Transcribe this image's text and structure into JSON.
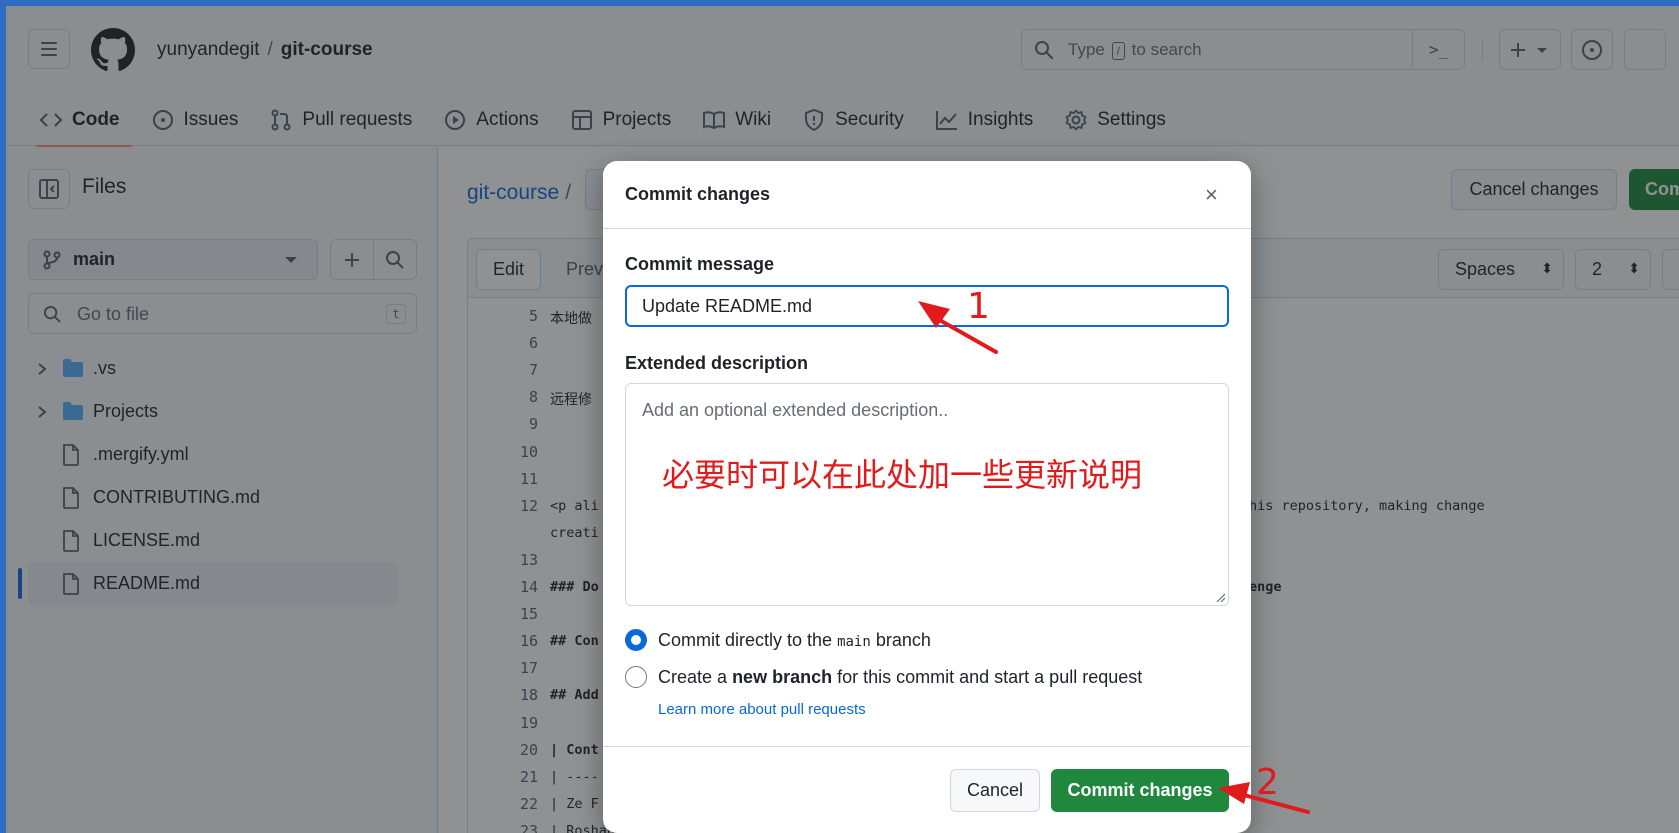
{
  "header": {
    "owner": "yunyandegit",
    "separator": "/",
    "repo": "git-course",
    "search_placeholder_before": "Type",
    "search_key": "/",
    "search_placeholder_after": "to search",
    "command_glyph": ">_"
  },
  "nav": {
    "tabs": [
      {
        "label": "Code",
        "icon": "code-icon"
      },
      {
        "label": "Issues",
        "icon": "issue-icon"
      },
      {
        "label": "Pull requests",
        "icon": "pull-request-icon"
      },
      {
        "label": "Actions",
        "icon": "play-icon"
      },
      {
        "label": "Projects",
        "icon": "table-icon"
      },
      {
        "label": "Wiki",
        "icon": "book-icon"
      },
      {
        "label": "Security",
        "icon": "shield-icon"
      },
      {
        "label": "Insights",
        "icon": "graph-icon"
      },
      {
        "label": "Settings",
        "icon": "gear-icon"
      }
    ]
  },
  "sidebar": {
    "title": "Files",
    "branch": "main",
    "goto_placeholder": "Go to file",
    "goto_key": "t",
    "items": [
      {
        "label": ".vs",
        "type": "folder"
      },
      {
        "label": "Projects",
        "type": "folder"
      },
      {
        "label": ".mergify.yml",
        "type": "file"
      },
      {
        "label": "CONTRIBUTING.md",
        "type": "file"
      },
      {
        "label": "LICENSE.md",
        "type": "file"
      },
      {
        "label": "README.md",
        "type": "file",
        "selected": true
      }
    ]
  },
  "main": {
    "path_repo": "git-course",
    "path_sep": "/",
    "cancel_label": "Cancel changes",
    "commit_label": "Com",
    "edit_tab": "Edit",
    "preview_tab": "Previ",
    "indent_mode": "Spaces",
    "indent_size": "2",
    "lines": [
      {
        "n": "5",
        "text": "本地做",
        "style": "cn"
      },
      {
        "n": "6",
        "text": ""
      },
      {
        "n": "7",
        "text": ""
      },
      {
        "n": "8",
        "text": "远程修",
        "style": "cn"
      },
      {
        "n": "9",
        "text": ""
      },
      {
        "n": "10",
        "text": ""
      },
      {
        "n": "11",
        "text": ""
      },
      {
        "n": "12",
        "text": "<p ali                                                           e, first by forking this repository, making change"
      },
      {
        "n": "",
        "text": "creati"
      },
      {
        "n": "13",
        "text": ""
      },
      {
        "n": "14",
        "text": "### Do                                                            re part of the challenge",
        "style": "b"
      },
      {
        "n": "15",
        "text": ""
      },
      {
        "n": "16",
        "text": "## Con",
        "style": "b"
      },
      {
        "n": "17",
        "text": ""
      },
      {
        "n": "18",
        "text": "## Add                                                            ow!",
        "style": "b"
      },
      {
        "n": "19",
        "text": ""
      },
      {
        "n": "20",
        "text": "| Cont                                                              |",
        "style": "b"
      },
      {
        "n": "21",
        "text": "| ----                                                           -- |"
      },
      {
        "n": "22",
        "text": "| Ze F                                                              |"
      },
      {
        "n": "23",
        "text": "| Roshan                                                |programming, cybersecurity|"
      }
    ]
  },
  "modal": {
    "title": "Commit changes",
    "close_glyph": "×",
    "message_label": "Commit message",
    "message_value": "Update README.md",
    "desc_label": "Extended description",
    "desc_placeholder": "Add an optional extended description..",
    "radio_direct_before": "Commit directly to the",
    "radio_direct_branch": "main",
    "radio_direct_after": "branch",
    "radio_new_before": "Create a",
    "radio_new_bold": "new branch",
    "radio_new_after": "for this commit and start a pull request",
    "learn_more": "Learn more about pull requests",
    "cancel": "Cancel",
    "commit": "Commit changes"
  },
  "annotations": {
    "num1": "1",
    "num2": "2",
    "note": "必要时可以在此处加一些更新说明"
  },
  "colors": {
    "accent_blue": "#0969da",
    "commit_green": "#1f883d",
    "annotation_red": "#e01b1b",
    "tab_underline": "#fd8c73"
  }
}
